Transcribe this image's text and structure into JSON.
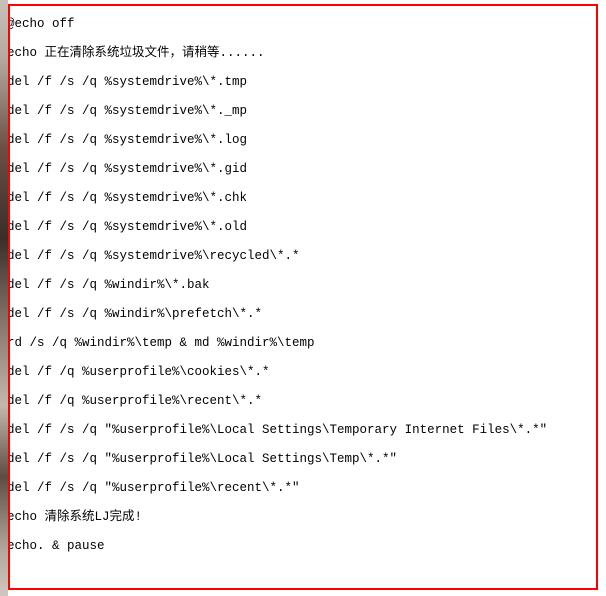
{
  "script": {
    "lines": [
      "@echo off",
      "echo 正在清除系统垃圾文件，请稍等......",
      "del /f /s /q %systemdrive%\\*.tmp",
      "del /f /s /q %systemdrive%\\*._mp",
      "del /f /s /q %systemdrive%\\*.log",
      "del /f /s /q %systemdrive%\\*.gid",
      "del /f /s /q %systemdrive%\\*.chk",
      "del /f /s /q %systemdrive%\\*.old",
      "del /f /s /q %systemdrive%\\recycled\\*.*",
      "del /f /s /q %windir%\\*.bak",
      "del /f /s /q %windir%\\prefetch\\*.*",
      "rd /s /q %windir%\\temp & md %windir%\\temp",
      "del /f /q %userprofile%\\cookies\\*.*",
      "del /f /q %userprofile%\\recent\\*.*",
      "del /f /s /q \"%userprofile%\\Local Settings\\Temporary Internet Files\\*.*\"",
      "del /f /s /q \"%userprofile%\\Local Settings\\Temp\\*.*\"",
      "del /f /s /q \"%userprofile%\\recent\\*.*\"",
      "echo 清除系统LJ完成!",
      "echo. & pause"
    ]
  }
}
